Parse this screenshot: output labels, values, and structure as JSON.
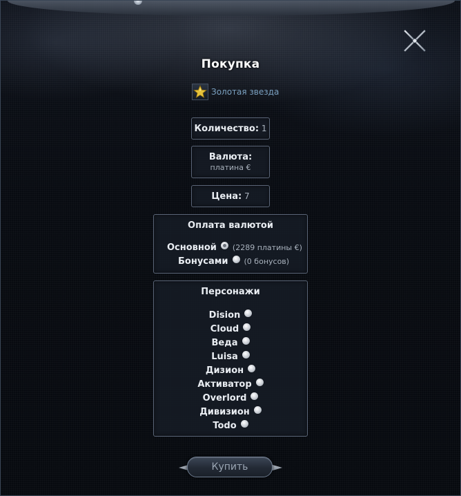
{
  "dialog": {
    "title": "Покупка"
  },
  "item": {
    "icon": "gold-star-icon",
    "name": "Золотая звезда"
  },
  "quantity": {
    "label": "Количество:",
    "value": "1"
  },
  "currency": {
    "label": "Валюта:",
    "value": "платина €"
  },
  "price": {
    "label": "Цена:",
    "value": "7"
  },
  "payment": {
    "title": "Оплата валютой",
    "options": [
      {
        "label": "Основной",
        "note": "(2289 платины €)",
        "selected": true
      },
      {
        "label": "Бонусами",
        "note": "(0 бонусов)",
        "selected": false
      }
    ]
  },
  "characters": {
    "title": "Персонажи",
    "items": [
      {
        "name": "Dision"
      },
      {
        "name": "Cloud"
      },
      {
        "name": "Веда"
      },
      {
        "name": "Luisa"
      },
      {
        "name": "Дизион"
      },
      {
        "name": "Активатор"
      },
      {
        "name": "Overlord"
      },
      {
        "name": "Дивизион"
      },
      {
        "name": "Todo"
      }
    ]
  },
  "actions": {
    "buy_label": "Купить"
  },
  "colors": {
    "background": "#080b11",
    "panel_border": "#5b6678",
    "item_link": "#7aa0c0",
    "label_text": "#e9edf2",
    "value_text": "#a9b2bd"
  }
}
